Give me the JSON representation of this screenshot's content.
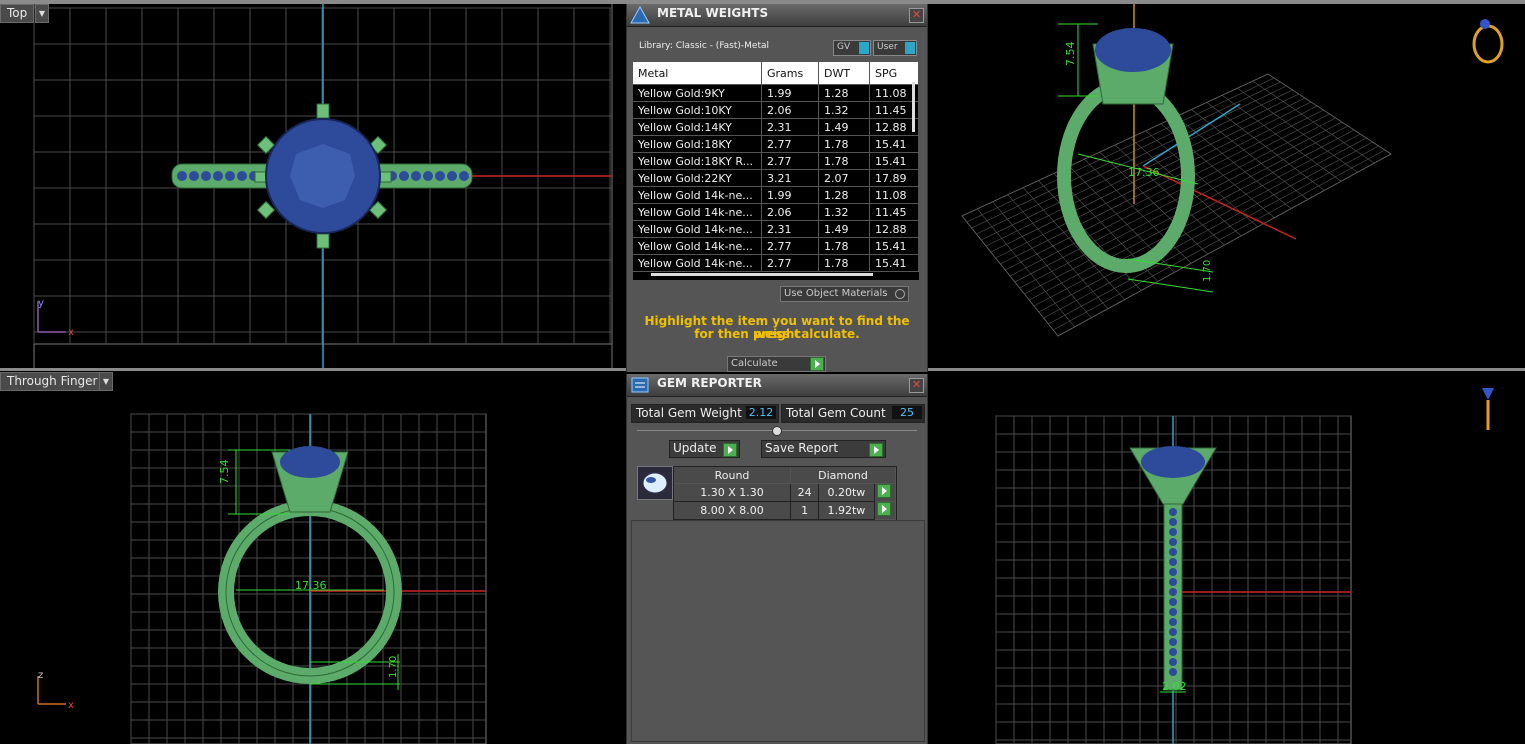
{
  "viewports": {
    "top_left": {
      "label": "Top",
      "axes": {
        "y": "y",
        "x": "x"
      }
    },
    "bottom_left": {
      "label": "Through Finger",
      "axes": {
        "z": "z",
        "x": "x"
      },
      "dims": {
        "height": "7.54",
        "width": "17.36",
        "band": "1.70"
      }
    },
    "top_right": {
      "dims": {
        "height": "7.54",
        "width": "17.36",
        "band": "1.70"
      }
    },
    "bottom_right": {
      "dims": {
        "width": "2.02"
      }
    }
  },
  "metal_weights": {
    "title": "METAL WEIGHTS",
    "library": "Library: Classic - (Fast)-Metal",
    "gv_label": "GV",
    "user_label": "User",
    "columns": [
      "Metal",
      "Grams",
      "DWT",
      "SPG"
    ],
    "rows": [
      [
        "Yellow Gold:9KY",
        "1.99",
        "1.28",
        "11.08"
      ],
      [
        "Yellow Gold:10KY",
        "2.06",
        "1.32",
        "11.45"
      ],
      [
        "Yellow Gold:14KY",
        "2.31",
        "1.49",
        "12.88"
      ],
      [
        "Yellow Gold:18KY",
        "2.77",
        "1.78",
        "15.41"
      ],
      [
        "Yellow Gold:18KY R...",
        "2.77",
        "1.78",
        "15.41"
      ],
      [
        "Yellow Gold:22KY",
        "3.21",
        "2.07",
        "17.89"
      ],
      [
        "Yellow Gold 14k-ne...",
        "1.99",
        "1.28",
        "11.08"
      ],
      [
        "Yellow Gold 14k-ne...",
        "2.06",
        "1.32",
        "11.45"
      ],
      [
        "Yellow Gold 14k-ne...",
        "2.31",
        "1.49",
        "12.88"
      ],
      [
        "Yellow Gold 14k-ne...",
        "2.77",
        "1.78",
        "15.41"
      ],
      [
        "Yellow Gold 14k-ne...",
        "2.77",
        "1.78",
        "15.41"
      ]
    ],
    "use_object_materials": "Use Object Materials",
    "hint_line1": "Highlight the item you want to find the weight",
    "hint_line2": "for then press calculate.",
    "calculate": "Calculate"
  },
  "gem_reporter": {
    "title": "GEM REPORTER",
    "total_weight_label": "Total Gem Weight",
    "total_weight": "2.12",
    "total_count_label": "Total Gem Count",
    "total_count": "25",
    "update": "Update",
    "save_report": "Save Report",
    "shape": "Round",
    "material": "Diamond",
    "rows": [
      {
        "size": "1.30 X 1.30",
        "count": "24",
        "tw": "0.20tw"
      },
      {
        "size": "8.00 X 8.00",
        "count": "1",
        "tw": "1.92tw"
      }
    ]
  },
  "colors": {
    "metal": "#5cab6a",
    "gem": "#2e4a9a",
    "dim": "#33dd33",
    "accent": "#f0c000"
  }
}
